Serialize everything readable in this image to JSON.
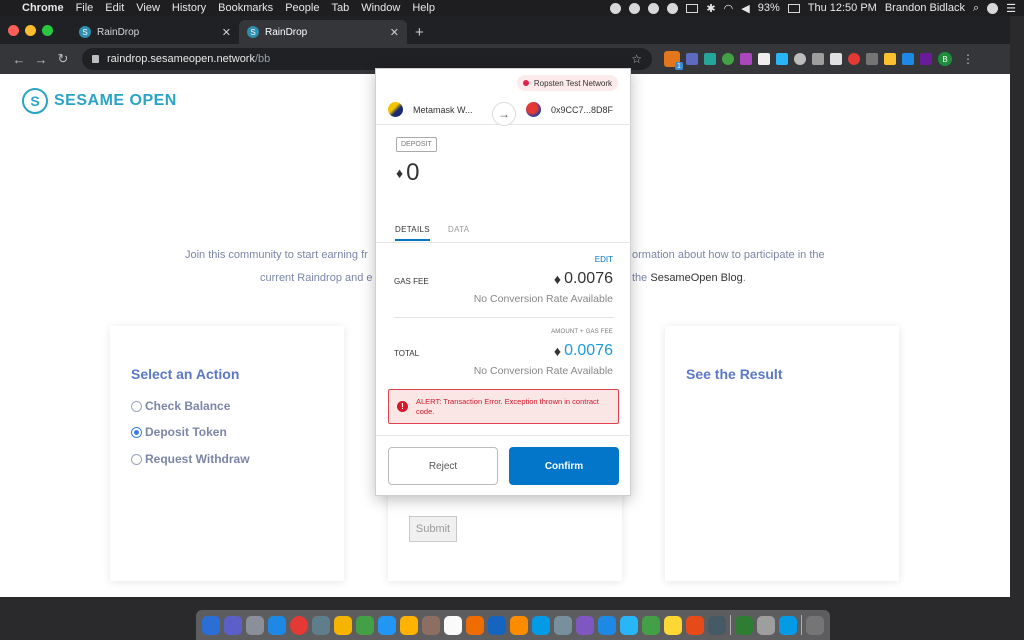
{
  "menubar": {
    "app": "Chrome",
    "items": [
      "File",
      "Edit",
      "View",
      "History",
      "Bookmarks",
      "People",
      "Tab",
      "Window",
      "Help"
    ],
    "battery": "93%",
    "clock": "Thu 12:50 PM",
    "user": "Brandon Bidlack"
  },
  "tabs": [
    {
      "title": "RainDrop"
    },
    {
      "title": "RainDrop"
    }
  ],
  "omnibox": {
    "domain": "raindrop.sesameopen.network",
    "path": "/bb"
  },
  "profile_initial": "B",
  "metamask_badge": "1",
  "page": {
    "brand": "SESAME OPEN",
    "intro_line1_left": "Join this community to start earning fr",
    "intro_line1_right": "ormation about how to participate in the",
    "intro_line2_left": "current Raindrop and e",
    "intro_line2_right": "the",
    "intro_blog": "SesameOpen Blog",
    "intro_blog_end": ".",
    "select_action_title": "Select an Action",
    "options": [
      "Check Balance",
      "Deposit Token",
      "Request Withdraw"
    ],
    "selected_option": "Deposit Token",
    "submit_label": "Submit",
    "result_title": "See the Result"
  },
  "metamask": {
    "network": "Ropsten Test Network",
    "from_account": "Metamask W...",
    "to_account": "0x9CC7...8D8F",
    "tx_type": "DEPOSIT",
    "amount": "0",
    "tabs": [
      "DETAILS",
      "DATA"
    ],
    "edit_label": "EDIT",
    "gas_fee_label": "GAS FEE",
    "gas_fee_value": "0.0076",
    "gas_fee_sub": "No Conversion Rate Available",
    "amount_gas_label": "AMOUNT + GAS FEE",
    "total_label": "TOTAL",
    "total_value": "0.0076",
    "total_sub": "No Conversion Rate Available",
    "alert": "ALERT: Transaction Error. Exception thrown in contract code.",
    "reject_label": "Reject",
    "confirm_label": "Confirm"
  },
  "colors": {
    "accent": "#0376c9",
    "brand": "#2aa4c4",
    "heading": "#5b79c8",
    "error": "#d5172a"
  }
}
